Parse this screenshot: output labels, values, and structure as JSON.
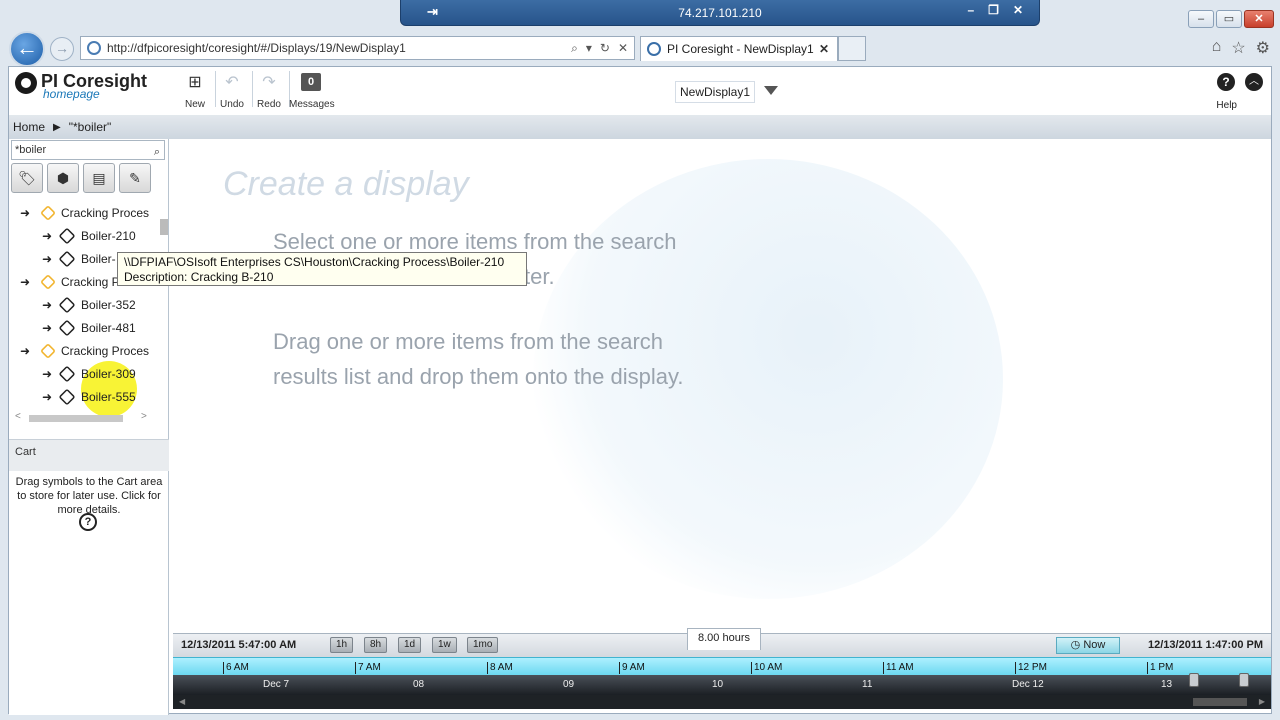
{
  "remote": {
    "ip": "74.217.101.210"
  },
  "browser": {
    "url": "http://dfpicoresight/coresight/#/Displays/19/NewDisplay1",
    "tab_title": "PI Coresight - NewDisplay1"
  },
  "app": {
    "logo_name": "PI Coresight",
    "logo_sub": "homepage",
    "toolbar": {
      "new": "New",
      "undo": "Undo",
      "redo": "Redo",
      "messages": "Messages",
      "messages_count": "0"
    },
    "display_name": "NewDisplay1",
    "help_label": "Help"
  },
  "breadcrumb": {
    "home": "Home",
    "current": "\"*boiler\""
  },
  "search": {
    "value": "*boiler"
  },
  "tree": [
    {
      "label": "Cracking Proces",
      "type": "element"
    },
    {
      "label": "Boiler-210",
      "type": "asset"
    },
    {
      "label": "Boiler-",
      "type": "asset"
    },
    {
      "label": "Cracking P",
      "type": "element"
    },
    {
      "label": "Boiler-352",
      "type": "asset"
    },
    {
      "label": "Boiler-481",
      "type": "asset"
    },
    {
      "label": "Cracking Proces",
      "type": "element"
    },
    {
      "label": "Boiler-309",
      "type": "asset"
    },
    {
      "label": "Boiler-555",
      "type": "asset"
    }
  ],
  "tooltip": {
    "path": "\\\\DFPIAF\\OSIsoft Enterprises CS\\Houston\\Cracking Process\\Boiler-210",
    "description": "Description: Cracking B-210"
  },
  "cart": {
    "title": "Cart",
    "text": "Drag symbols to the Cart area to store for later use. Click for more details."
  },
  "display": {
    "heading": "Create a display",
    "line1": "Select one or more items from the search",
    "line2": "ter.",
    "line3": "Drag one or more items from the search",
    "line4": "results list and drop them onto the display."
  },
  "timeline": {
    "start": "12/13/2011 5:47:00 AM",
    "end": "12/13/2011 1:47:00 PM",
    "duration": "8.00 hours",
    "now": "Now",
    "ranges": [
      "1h",
      "8h",
      "1d",
      "1w",
      "1mo"
    ],
    "hours": [
      "6 AM",
      "7 AM",
      "8 AM",
      "9 AM",
      "10 AM",
      "11 AM",
      "12 PM",
      "1 PM"
    ],
    "days": [
      "Dec 7",
      "08",
      "09",
      "10",
      "11",
      "Dec 12",
      "13"
    ]
  }
}
